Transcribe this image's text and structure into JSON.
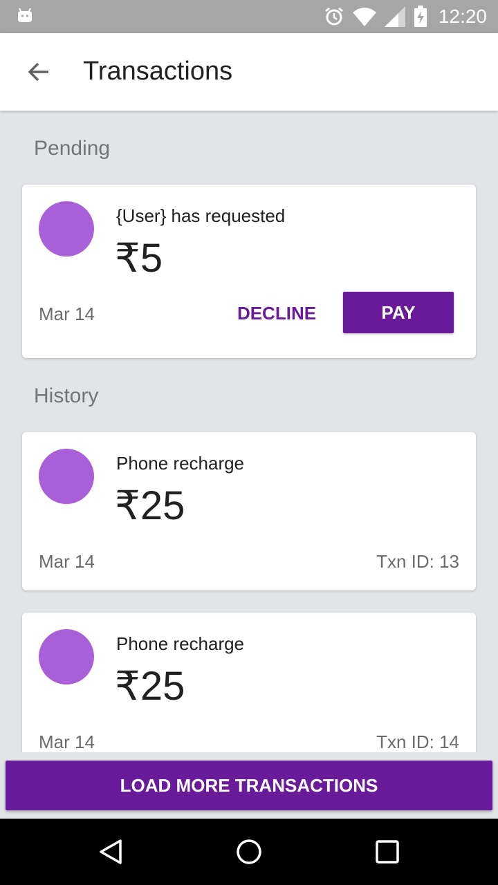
{
  "status_bar": {
    "time": "12:20",
    "icons": [
      "android-icon",
      "alarm-icon",
      "wifi-icon",
      "signal-icon",
      "battery-charging-icon"
    ]
  },
  "app_bar": {
    "back_icon": "arrow-back-icon",
    "title": "Transactions"
  },
  "pending": {
    "section_title": "Pending",
    "card": {
      "description": "{User} has requested",
      "amount": "₹5",
      "date": "Mar 14",
      "decline_label": "DECLINE",
      "pay_label": "PAY"
    }
  },
  "history": {
    "section_title": "History",
    "items": [
      {
        "description": "Phone recharge",
        "amount": "₹25",
        "date": "Mar 14",
        "txn_id": "Txn ID: 13"
      },
      {
        "description": "Phone recharge",
        "amount": "₹25",
        "date": "Mar 14",
        "txn_id": "Txn ID: 14"
      }
    ]
  },
  "load_more_label": "LOAD MORE TRANSACTIONS",
  "nav_bar": {
    "icons": [
      "back-triangle-icon",
      "home-circle-icon",
      "recents-square-icon"
    ]
  },
  "colors": {
    "accent": "#6a1b9a",
    "avatar": "#a95fd8",
    "background": "#e1e5e8",
    "status_bar": "#a6a6a6"
  }
}
